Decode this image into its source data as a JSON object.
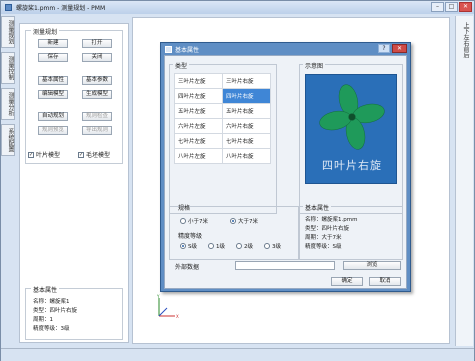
{
  "window": {
    "title": "螺旋桨1.pmm - 测量规划 - PMM",
    "min": "–",
    "max": "□",
    "close": "✕"
  },
  "left_tabs": [
    "测量规划",
    "测量控制",
    "测量分析",
    "系统配置"
  ],
  "right_tabs": "上下左右前后",
  "measure_plan": {
    "title": "测量规划",
    "buttons": {
      "new": "新建",
      "open": "打开",
      "save": "保存",
      "close": "关闭",
      "basic_attr": "基本属性",
      "basic_param": "基本参数",
      "edit_model": "编辑模型",
      "gen_model": "生成模型",
      "auto_plan": "自动规划",
      "rule_check": "规则检查",
      "plan_preview": "规则预览",
      "export_plan": "导出规则"
    },
    "checks": {
      "blade_model": "叶片模型",
      "hub_model": "毛坯模型"
    },
    "blade_checked": true,
    "hub_checked": true
  },
  "info": {
    "title": "基本属性",
    "lines": [
      "名称：螺旋桨1",
      "类型：四叶片右旋",
      "周期：1",
      "精度等级：3级"
    ]
  },
  "dialog": {
    "title": "基本属性",
    "help": "?",
    "close": "✕",
    "type_label": "类型",
    "types": [
      [
        "三叶片左旋",
        "三叶片右旋"
      ],
      [
        "四叶片左旋",
        "四叶片右旋"
      ],
      [
        "五叶片左旋",
        "五叶片右旋"
      ],
      [
        "六叶片左旋",
        "六叶片右旋"
      ],
      [
        "七叶片左旋",
        "七叶片右旋"
      ],
      [
        "八叶片左旋",
        "八叶片右旋"
      ]
    ],
    "selected": [
      1,
      1
    ],
    "preview_label": "示意图",
    "preview_caption": "四叶片右旋",
    "period_label": "规格",
    "period_options": [
      "小于7米",
      "大于7米"
    ],
    "period_selected": 1,
    "grade_label": "精度等级",
    "grade_options": [
      "S级",
      "1级",
      "2级",
      "3级"
    ],
    "grade_selected": 0,
    "basic_label": "基本属性",
    "basic_lines": [
      "名称：螺旋桨1.pmm",
      "类型：四叶片右旋",
      "周期：大于7米",
      "精度等级：S级"
    ],
    "external_label": "外部数据",
    "external_value": "",
    "browse": "浏览",
    "ok": "确定",
    "cancel": "取消"
  },
  "colors": {
    "accent": "#3f86d6",
    "preview_bg": "#2a6fb8",
    "propeller": "#1f9a5a",
    "dialog_frame": "#5f8ec4"
  }
}
